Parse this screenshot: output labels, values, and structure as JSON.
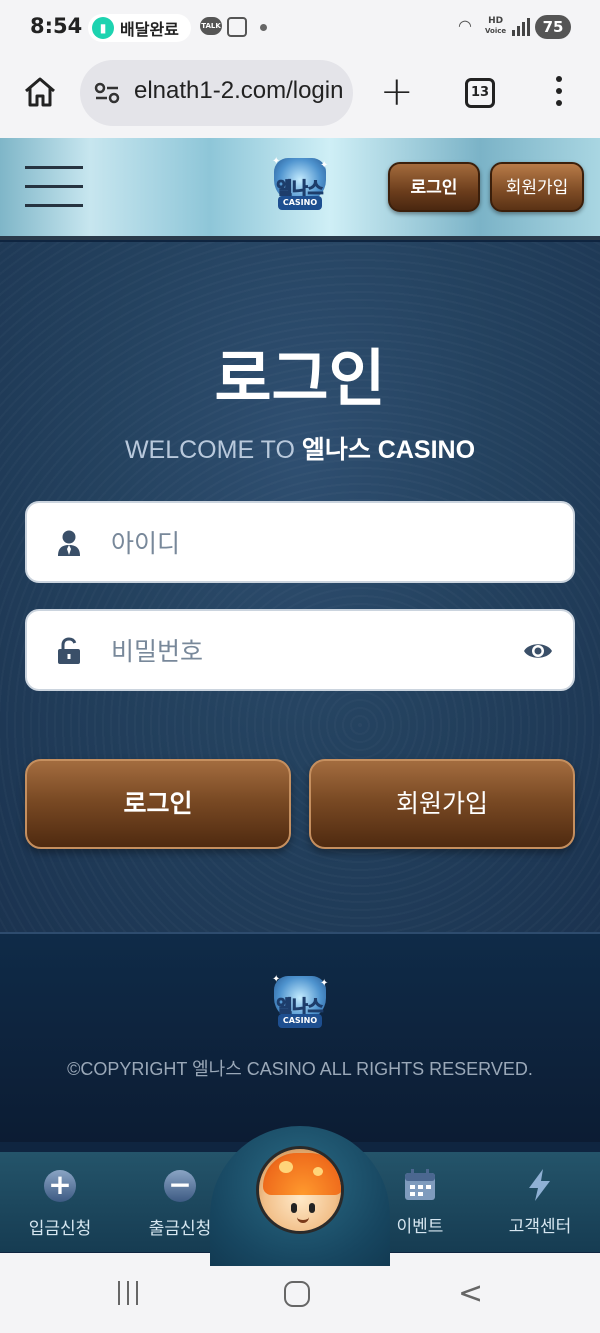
{
  "status_bar": {
    "time": "8:54",
    "chip_label": "배달완료",
    "talk_label": "TALK",
    "hd_label": "HD",
    "voice_label": "Voice",
    "battery": "75"
  },
  "browser": {
    "url": "elnath1-2.com/login",
    "tab_count": "13"
  },
  "header": {
    "logo_title": "엘나스",
    "logo_sub": "CASINO",
    "login_label": "로그인",
    "join_label": "회원가입"
  },
  "main": {
    "title": "로그인",
    "welcome_prefix": "WELCOME TO ",
    "welcome_brand": "엘나스 CASINO",
    "id_placeholder": "아이디",
    "pw_placeholder": "비밀번호",
    "login_button": "로그인",
    "join_button": "회원가입"
  },
  "footer": {
    "logo_title": "엘나스",
    "logo_sub": "CASINO",
    "copyright": "©COPYRIGHT 엘나스 CASINO ALL RIGHTS RESERVED."
  },
  "bottom_nav": {
    "deposit": "입금신청",
    "withdraw": "출금신청",
    "event": "이벤트",
    "support": "고객센터"
  },
  "colors": {
    "brand_brown": "#7a4a24",
    "main_bg": "#24425f",
    "header_sky": "#8ec6d8"
  },
  "icons": [
    "home-icon",
    "tune-icon",
    "plus-icon",
    "tabs-icon",
    "more-icon",
    "menu-icon",
    "user-icon",
    "lock-icon",
    "eye-icon",
    "plus-circle-icon",
    "minus-circle-icon",
    "calendar-icon",
    "lightning-icon"
  ]
}
